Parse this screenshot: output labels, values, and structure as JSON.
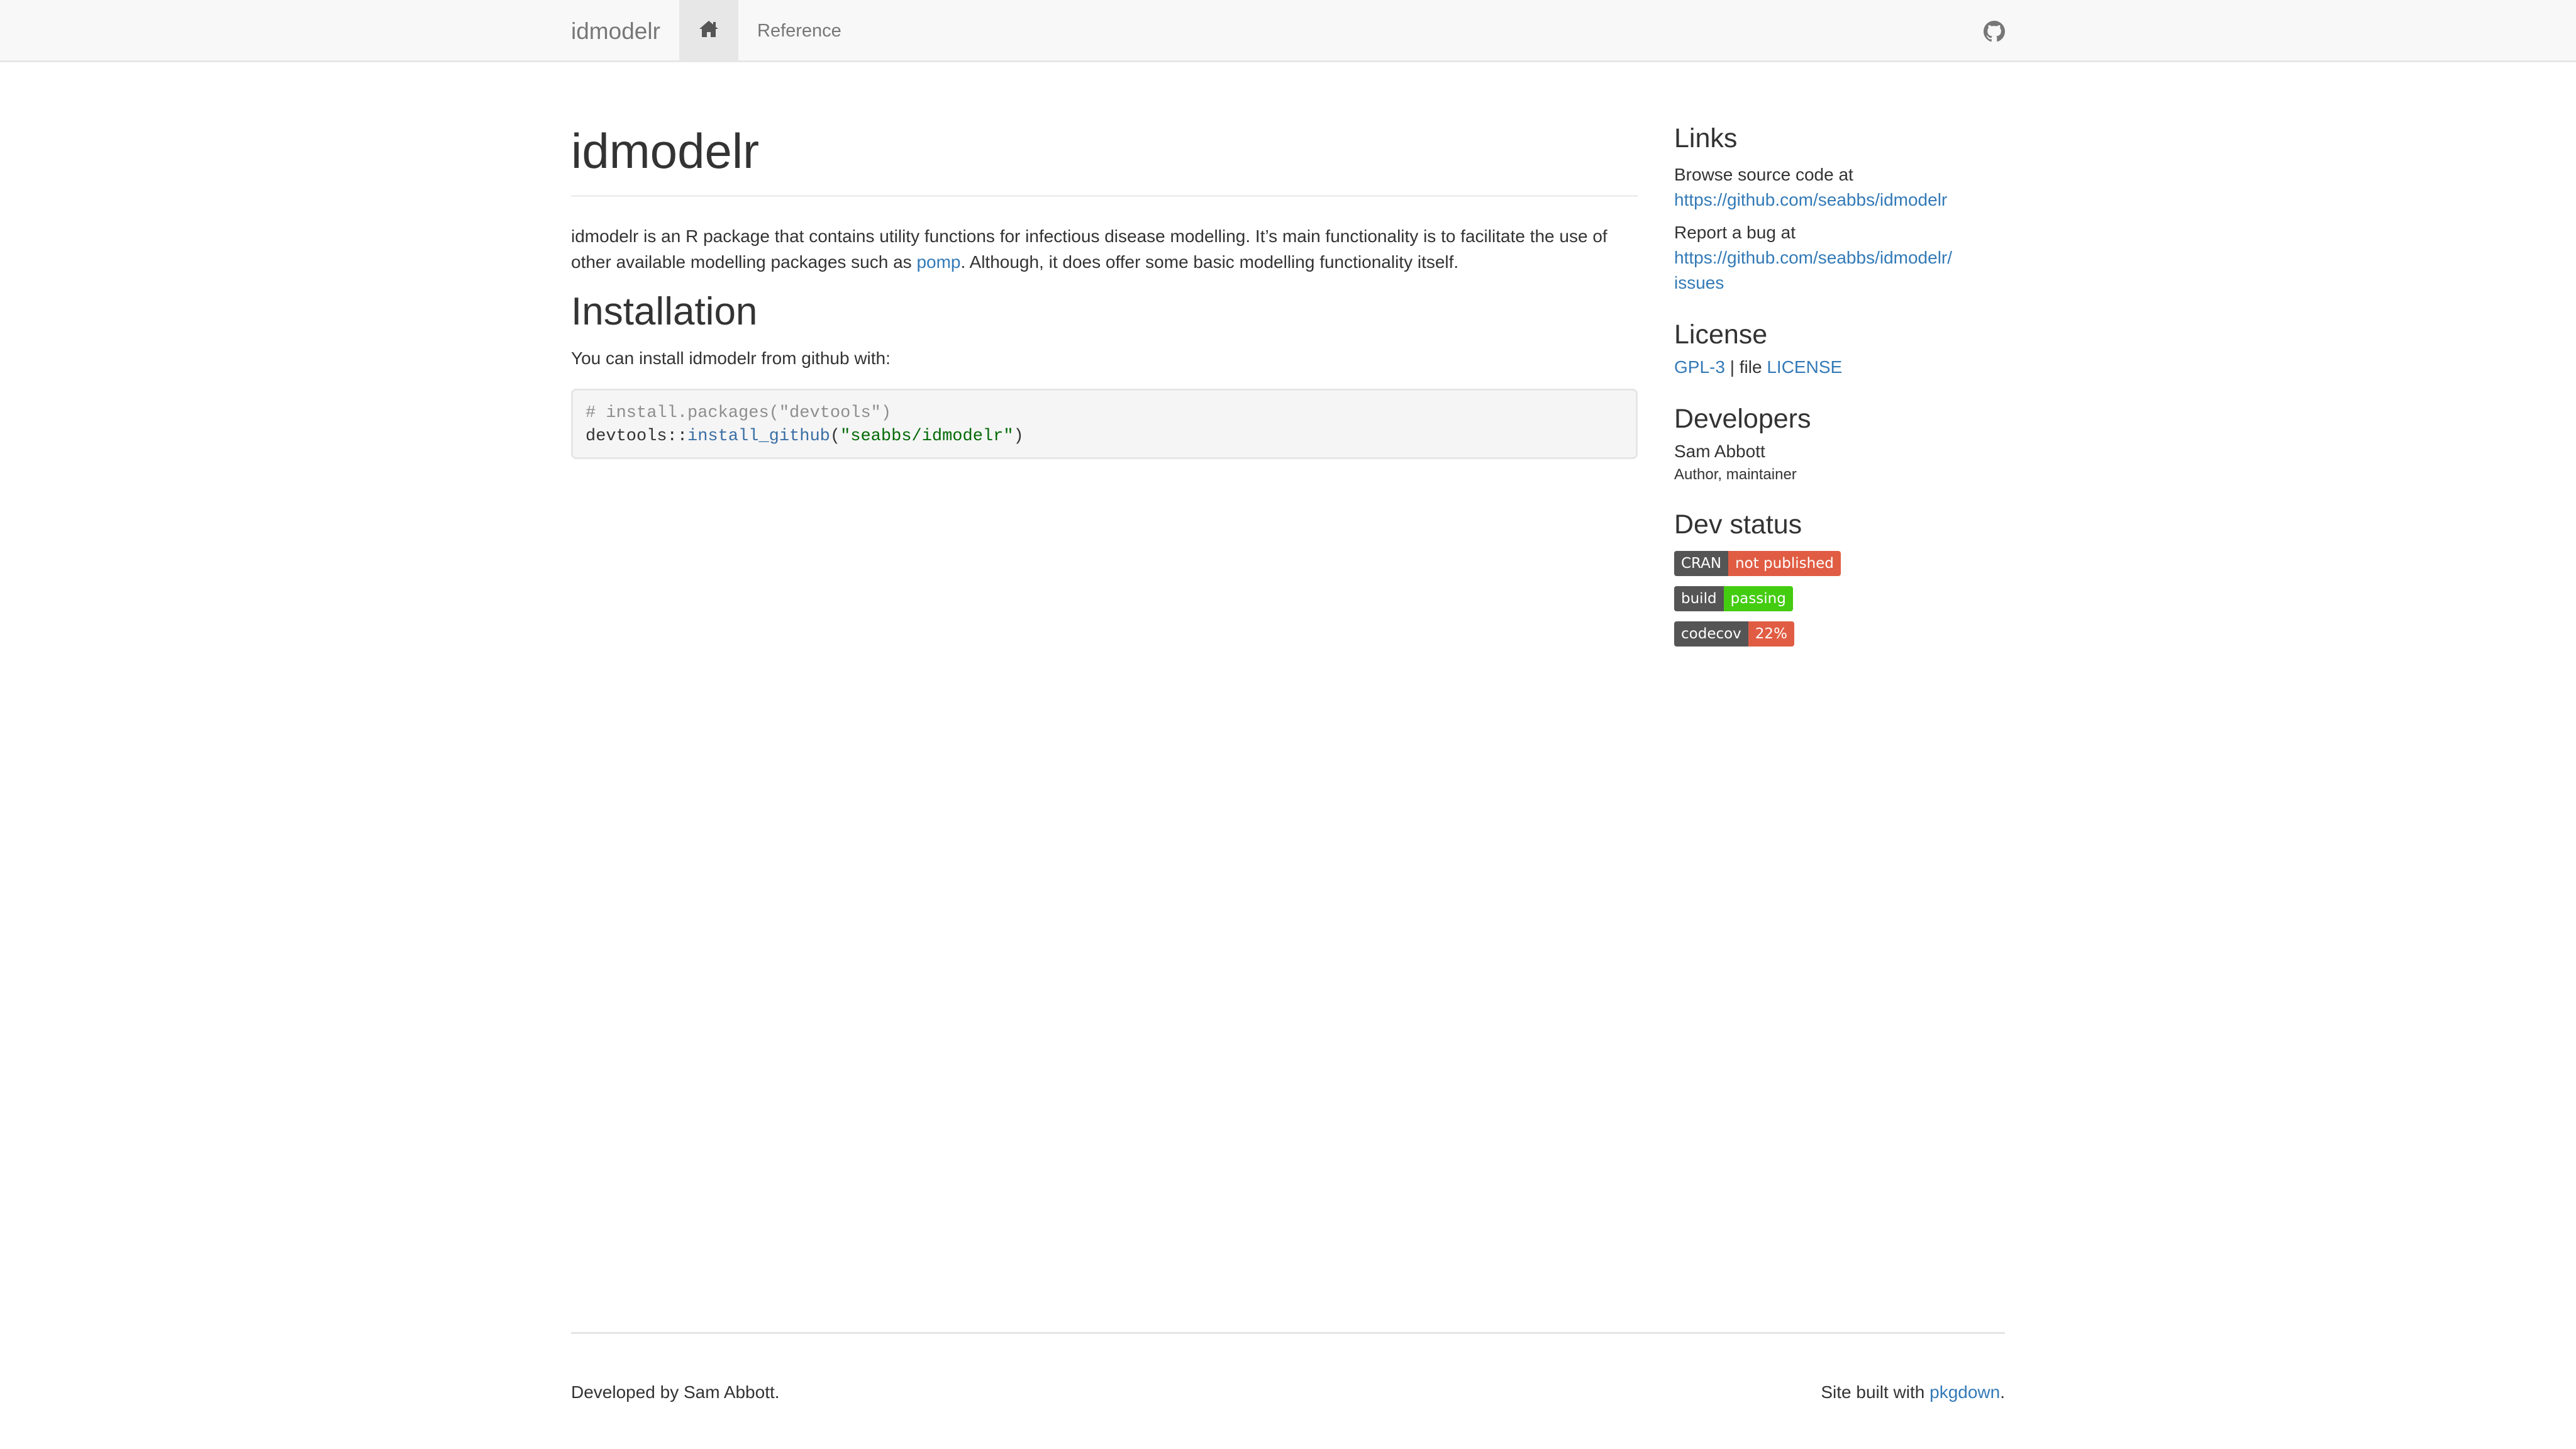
{
  "navbar": {
    "brand": "idmodelr",
    "home_icon": "home-icon",
    "reference_label": "Reference",
    "github_icon": "github-icon"
  },
  "main": {
    "title": "idmodelr",
    "intro_before": "idmodelr is an R package that contains utility functions for infectious disease modelling. It’s main functionality is to facilitate the use of other available modelling packages such as ",
    "intro_link": "pomp",
    "intro_after": ". Although, it does offer some basic modelling functionality itself.",
    "installation_heading": "Installation",
    "installation_text": "You can install idmodelr from github with:",
    "code": {
      "line1_comment": "# install.packages(\"devtools\")",
      "line2_pkg": "devtools::",
      "line2_fn": "install_github",
      "line2_open": "(",
      "line2_str": "\"seabbs/idmodelr\"",
      "line2_close": ")"
    }
  },
  "sidebar": {
    "links": {
      "heading": "Links",
      "browse_text": "Browse source code at",
      "browse_url": "https://github.com/seabbs/idmodelr",
      "bug_text": "Report a bug at",
      "bug_url_1": "https://github.com/seabbs/idmodelr/",
      "bug_url_2": "issues"
    },
    "license": {
      "heading": "License",
      "license_link": "GPL-3",
      "separator": " | file ",
      "file_link": "LICENSE"
    },
    "developers": {
      "heading": "Developers",
      "name": "Sam Abbott",
      "role": "Author, maintainer"
    },
    "dev_status": {
      "heading": "Dev status",
      "badges": [
        {
          "left": "CRAN",
          "right": "not published",
          "color": "#e05d44"
        },
        {
          "left": "build",
          "right": "passing",
          "color": "#4c1"
        },
        {
          "left": "codecov",
          "right": "22%",
          "color": "#e05d44"
        }
      ]
    }
  },
  "footer": {
    "left_text": "Developed by Sam Abbott.",
    "right_text": "Site built with ",
    "right_link": "pkgdown",
    "right_end": "."
  }
}
